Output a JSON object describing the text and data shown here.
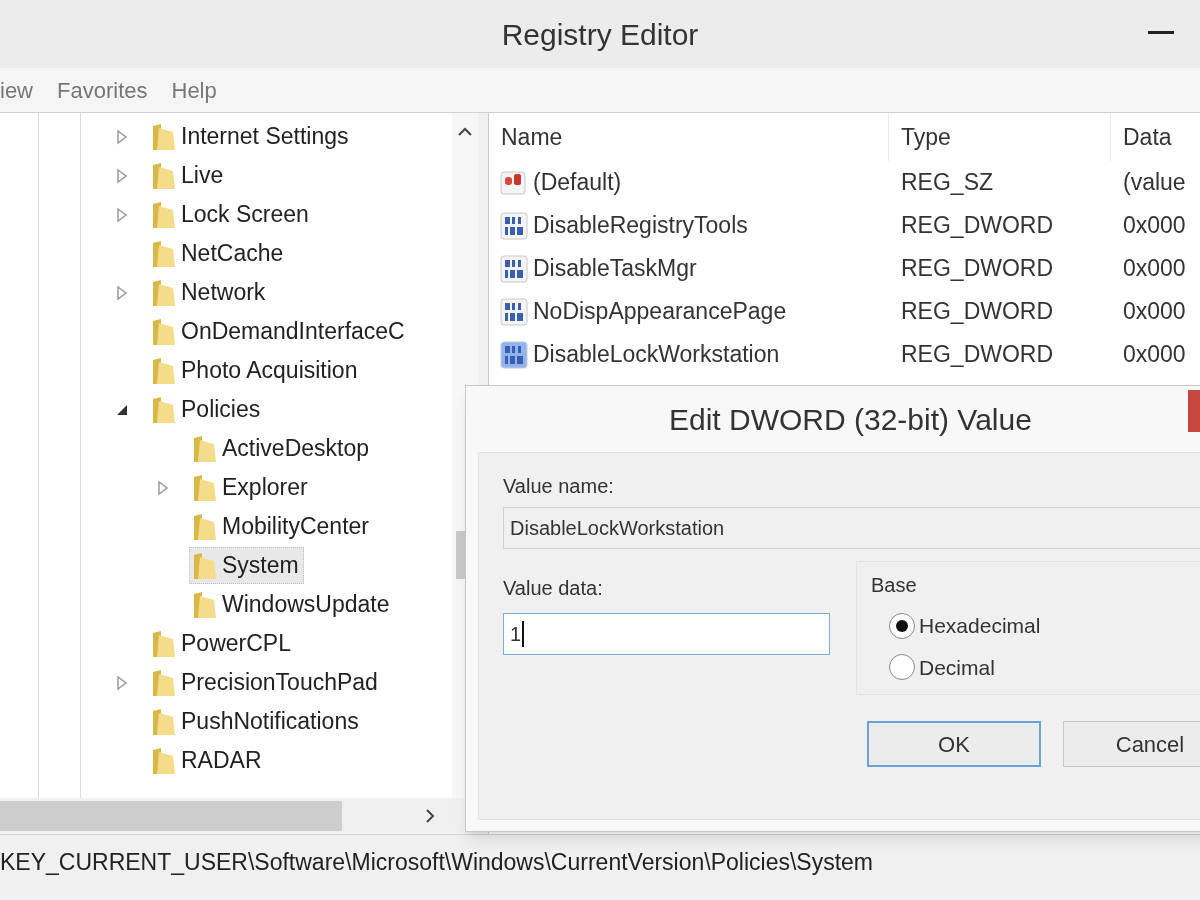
{
  "window": {
    "title": "Registry Editor"
  },
  "menu": [
    "iew",
    "Favorites",
    "Help"
  ],
  "tree": {
    "items": [
      {
        "label": "Internet Settings",
        "expandable": true,
        "expanded": false,
        "selected": false
      },
      {
        "label": "Live",
        "expandable": true,
        "expanded": false,
        "selected": false
      },
      {
        "label": "Lock Screen",
        "expandable": true,
        "expanded": false,
        "selected": false
      },
      {
        "label": "NetCache",
        "expandable": false,
        "selected": false
      },
      {
        "label": "Network",
        "expandable": true,
        "expanded": false,
        "selected": false
      },
      {
        "label": "OnDemandInterfaceC",
        "expandable": false,
        "selected": false
      },
      {
        "label": "Photo Acquisition",
        "expandable": false,
        "selected": false
      },
      {
        "label": "Policies",
        "expandable": true,
        "expanded": true,
        "selected": false,
        "children": [
          {
            "label": "ActiveDesktop",
            "expandable": false,
            "selected": false
          },
          {
            "label": "Explorer",
            "expandable": true,
            "expanded": false,
            "selected": false
          },
          {
            "label": "MobilityCenter",
            "expandable": false,
            "selected": false
          },
          {
            "label": "System",
            "expandable": false,
            "selected": true
          },
          {
            "label": "WindowsUpdate",
            "expandable": false,
            "selected": false
          }
        ]
      },
      {
        "label": "PowerCPL",
        "expandable": false,
        "selected": false
      },
      {
        "label": "PrecisionTouchPad",
        "expandable": true,
        "expanded": false,
        "selected": false
      },
      {
        "label": "PushNotifications",
        "expandable": false,
        "selected": false
      },
      {
        "label": "RADAR",
        "expandable": false,
        "selected": false
      }
    ]
  },
  "values": {
    "columns": [
      "Name",
      "Type",
      "Data"
    ],
    "rows": [
      {
        "kind": "string",
        "name": "(Default)",
        "type": "REG_SZ",
        "data": "(value",
        "selected": false
      },
      {
        "kind": "dword",
        "name": "DisableRegistryTools",
        "type": "REG_DWORD",
        "data": "0x000",
        "selected": false
      },
      {
        "kind": "dword",
        "name": "DisableTaskMgr",
        "type": "REG_DWORD",
        "data": "0x000",
        "selected": false
      },
      {
        "kind": "dword",
        "name": "NoDispAppearancePage",
        "type": "REG_DWORD",
        "data": "0x000",
        "selected": false
      },
      {
        "kind": "dword",
        "name": "DisableLockWorkstation",
        "type": "REG_DWORD",
        "data": "0x000",
        "selected": true
      }
    ]
  },
  "dialog": {
    "title": "Edit DWORD (32-bit) Value",
    "value_name_label": "Value name:",
    "value_name": "DisableLockWorkstation",
    "value_data_label": "Value data:",
    "value_data": "1",
    "base": {
      "label": "Base",
      "options": [
        {
          "label": "Hexadecimal",
          "selected": true
        },
        {
          "label": "Decimal",
          "selected": false
        }
      ]
    },
    "buttons": [
      {
        "label": "OK",
        "default": true
      },
      {
        "label": "Cancel",
        "default": false
      }
    ]
  },
  "status_bar": "KEY_CURRENT_USER\\Software\\Microsoft\\Windows\\CurrentVersion\\Policies\\System"
}
